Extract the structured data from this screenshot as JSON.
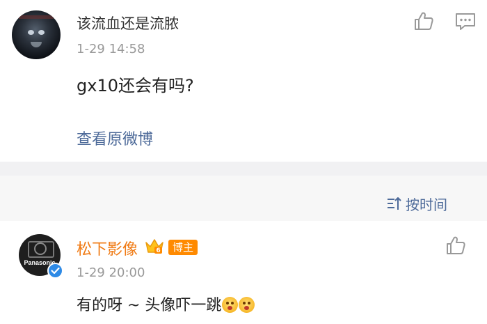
{
  "comment1": {
    "username": "该流血还是流脓",
    "time": "1-29 14:58",
    "text": "gx10还会有吗?",
    "view_original": "查看原微博",
    "avatar_icon": "user-avatar"
  },
  "sort": {
    "label": "按时间",
    "icon": "sort-icon"
  },
  "comment2": {
    "username": "松下影像",
    "badge": "博主",
    "time": "1-29 20:00",
    "text": "有的呀 ~ 头像吓一跳",
    "avatar_brand": "Panasonic",
    "emojis": [
      "surprised-emoji",
      "surprised-emoji"
    ]
  },
  "colors": {
    "link": "#4d6a99",
    "author_name": "#f07a13",
    "badge_bg": "#ff8a00",
    "verify": "#2e8ae6",
    "separator": "#f1f1f3",
    "sortbar_bg": "#f7f7f7"
  }
}
